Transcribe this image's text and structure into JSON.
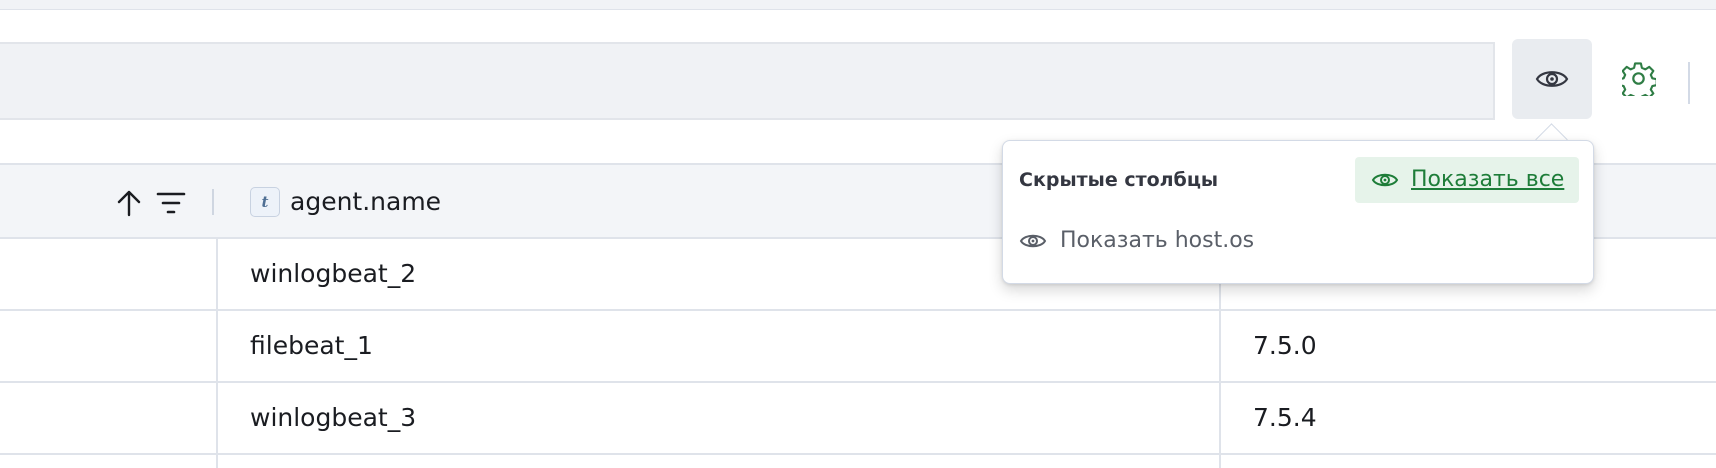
{
  "toolbar": {
    "visibility_icon": "eye-icon",
    "settings_icon": "gear-icon"
  },
  "table": {
    "header": {
      "sort_icon": "arrow-up-icon",
      "filter_icon": "filter-icon",
      "column_type_badge": "t",
      "column_title": "agent.name"
    },
    "rows": [
      {
        "agent_name": "winlogbeat_2",
        "version": ""
      },
      {
        "agent_name": "filebeat_1",
        "version": "7.5.0"
      },
      {
        "agent_name": "winlogbeat_3",
        "version": "7.5.4"
      }
    ]
  },
  "popover": {
    "title": "Скрытые столбцы",
    "show_all_label": "Показать все",
    "items": [
      {
        "label": "Показать host.os",
        "icon": "eye-icon"
      }
    ]
  },
  "colors": {
    "accent_green": "#1e7d39",
    "show_all_bg": "#e6f3ea",
    "header_bg": "#f3f5f8",
    "border": "#dfe3ea"
  }
}
